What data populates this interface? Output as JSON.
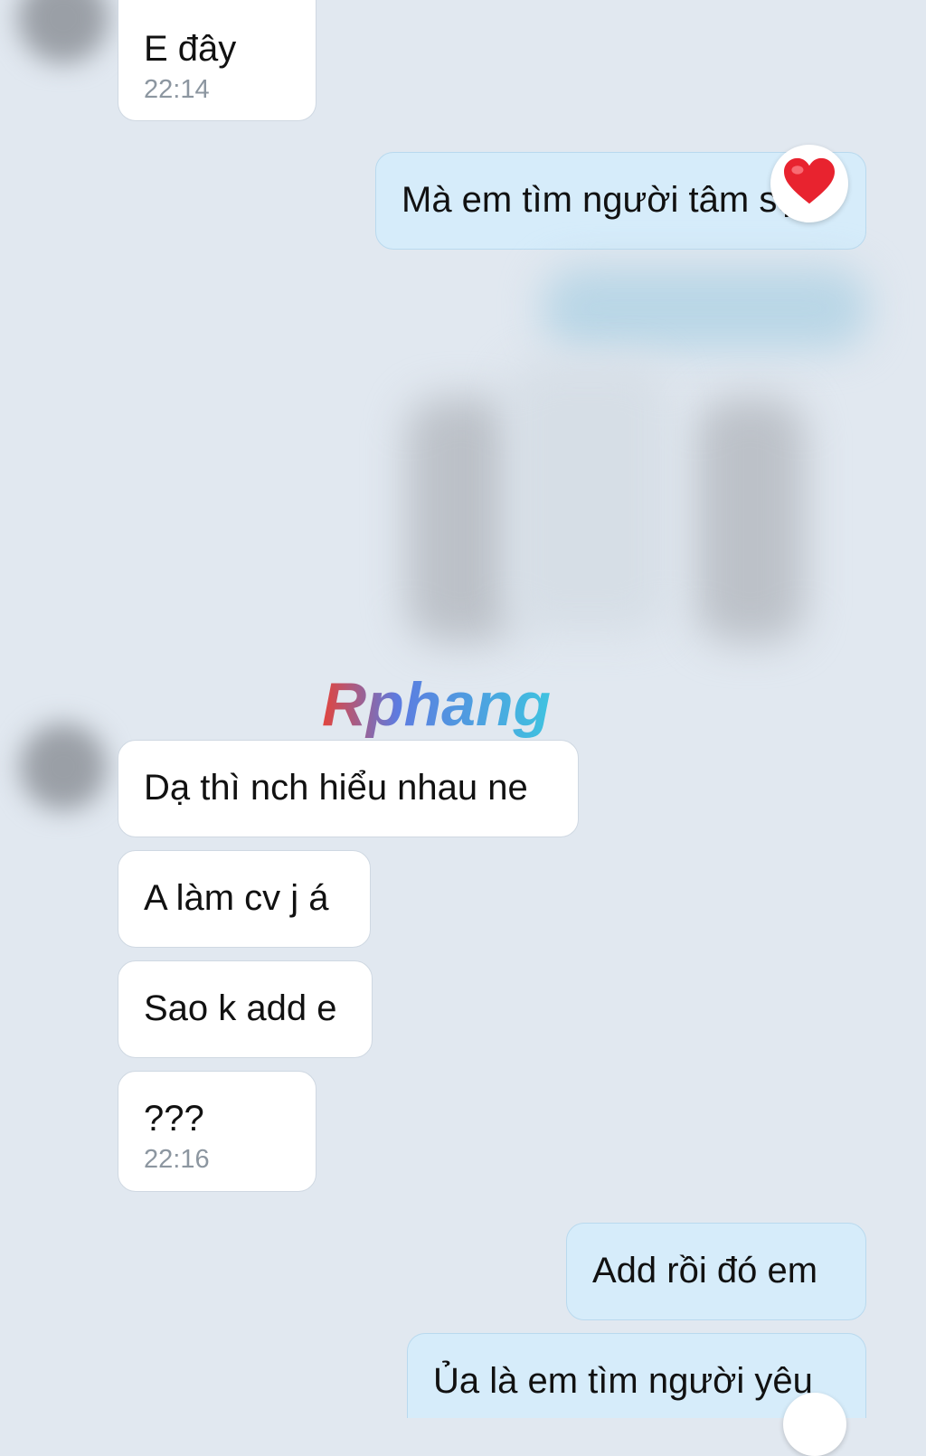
{
  "messages": [
    {
      "id": "m1",
      "text": "E đây",
      "time": "22:14",
      "side": "in"
    },
    {
      "id": "m2",
      "text": "Mà em tìm người tâm sự",
      "side": "out",
      "reaction": "heart"
    },
    {
      "id": "m3",
      "text": "Dạ thì nch hiểu nhau ne",
      "side": "in"
    },
    {
      "id": "m4",
      "text": "A làm cv j á",
      "side": "in"
    },
    {
      "id": "m5",
      "text": "Sao k add e",
      "side": "in"
    },
    {
      "id": "m6",
      "text": "???",
      "time": "22:16",
      "side": "in"
    },
    {
      "id": "m7",
      "text": "Add rồi đó em",
      "side": "out"
    },
    {
      "id": "m8",
      "text": "Ủa là em tìm người yêu",
      "side": "out"
    }
  ],
  "watermark": {
    "text": "Rphang"
  },
  "colors": {
    "background": "#e1e8f0",
    "incoming_bubble": "#ffffff",
    "outgoing_bubble": "#d6ecfa",
    "timestamp": "#8c96a0",
    "heart": "#e8232f"
  },
  "icons": {
    "reaction": "heart-icon"
  }
}
